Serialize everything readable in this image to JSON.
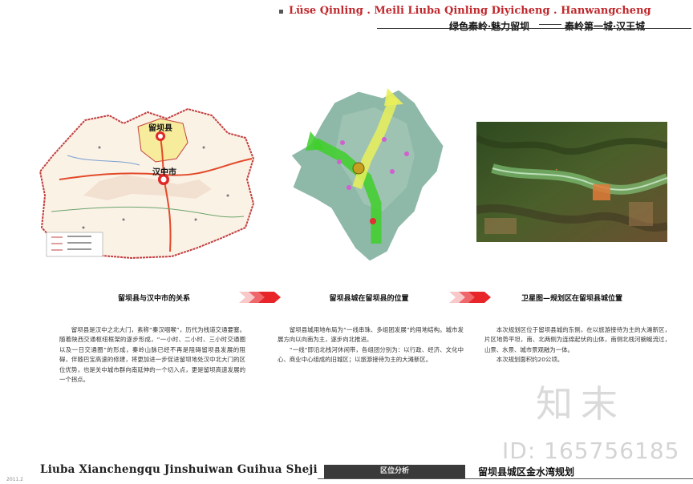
{
  "header": {
    "english": "Lüse  Qinling . Meili Liuba    Qinling Diyicheng . Hanwangcheng",
    "chinese_left": "绿色秦岭·魅力留坝",
    "chinese_right": "秦岭第一城·汉王城"
  },
  "panels": [
    {
      "caption": "留坝县与汉中市的关系",
      "map_labels": [
        "留坝县",
        "汉中市"
      ],
      "paragraphs": [
        "留坝县是汉中之北大门，素称“秦汉咽喉”，历代为栈道交通要塞。随着陕西交通枢纽框架的逐步形成，“一小时、二小时、三小时交通圈以及一日交通圈”的形成，秦岭山脉已经不再是阻碍留坝县发展的阻碍，伴随巴宝高速的修建，将更加进一步促进留坝地处汉中北大门的区位优势，也是关中城市群向南延伸的一个切入点，更是留坝高速发展的一个拐点。"
      ]
    },
    {
      "caption": "留坝县城在留坝县的位置",
      "paragraphs": [
        "留坝县城用地布局为“一线串珠、多组团发展”的用地结构。城市发展方向以向南为主，逐步向北推进。",
        "“一线”即沿北栈河休闲带，各组团分别为：以行政、经济、文化中心、商业中心组成的旧城区；以旅游接待为主的大滩新区。"
      ]
    },
    {
      "caption": "卫星图—规划区在留坝县城位置",
      "paragraphs": [
        "本次规划区位于留坝县城的东侧，在以旅游接待为主的大滩新区，片区地势平坦，南、北两侧为连绵起伏的山体，南侧北栈河蜿蜒流过，山景、水景、城市景观融为一体。",
        "本次规划面积约20公顷。"
      ]
    }
  ],
  "footer": {
    "english": "Liuba  Xianchengqu  Jinshuiwan  Guihua  Sheji",
    "tab": "区位分析",
    "chinese": "留坝县城区金水湾规划",
    "small": "2011.2"
  },
  "watermark": {
    "logo": "知末",
    "id": "ID: 165756185"
  },
  "colors": {
    "header_red": "#c0282d",
    "arrow_red": "#e8262a",
    "footer_tab": "#3a3a3a"
  }
}
